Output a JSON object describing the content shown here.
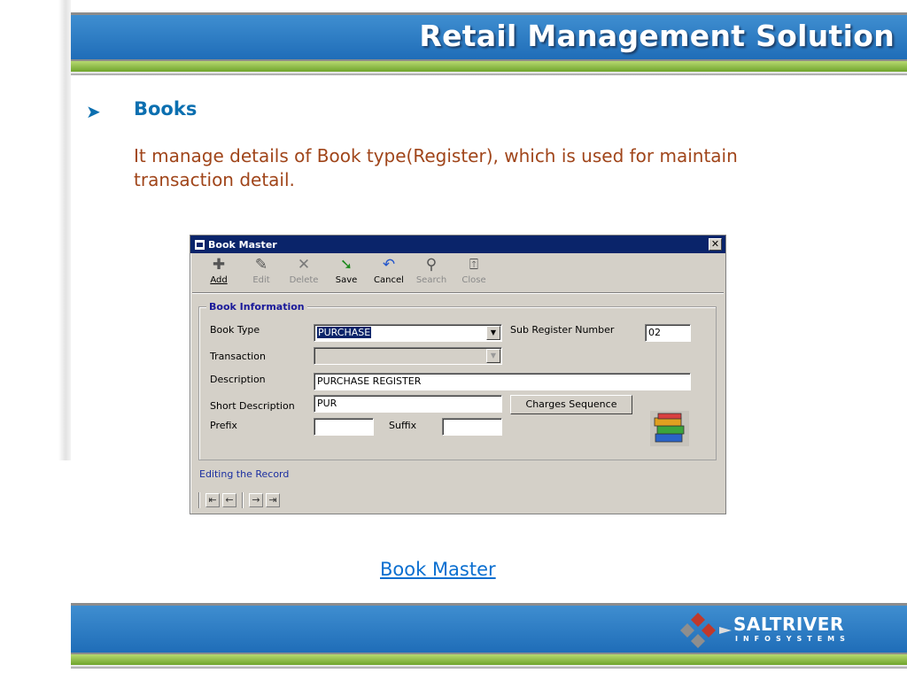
{
  "slide": {
    "header_title": "Retail Management Solution",
    "bullet": "➤",
    "heading": "Books",
    "paragraph": "It manage details of Book type(Register), which is used for maintain transaction detail.",
    "caption": "Book Master"
  },
  "window": {
    "title": "Book Master",
    "close_glyph": "✕",
    "toolbar": [
      {
        "label": "Add",
        "icon": "add-icon",
        "glyph": "✚",
        "enabled": true,
        "color": "#555555"
      },
      {
        "label": "Edit",
        "icon": "edit-icon",
        "glyph": "✎",
        "enabled": false,
        "color": "#555555"
      },
      {
        "label": "Delete",
        "icon": "delete-icon",
        "glyph": "✕",
        "enabled": false,
        "color": "#7a7a7a"
      },
      {
        "label": "Save",
        "icon": "save-icon",
        "glyph": "➘",
        "enabled": true,
        "color": "#1e8a1e"
      },
      {
        "label": "Cancel",
        "icon": "cancel-icon",
        "glyph": "↶",
        "enabled": true,
        "color": "#2255cc"
      },
      {
        "label": "Search",
        "icon": "search-icon",
        "glyph": "⚲",
        "enabled": false,
        "color": "#555555"
      },
      {
        "label": "Close",
        "icon": "close-icon",
        "glyph": "⍐",
        "enabled": false,
        "color": "#555555"
      }
    ],
    "group_title": "Book Information",
    "labels": {
      "book_type": "Book Type",
      "sub_register": "Sub Register Number",
      "transaction": "Transaction",
      "description": "Description",
      "short_description": "Short Description",
      "prefix": "Prefix",
      "suffix": "Suffix"
    },
    "values": {
      "book_type": "PURCHASE",
      "sub_register": "02",
      "transaction": "",
      "description": "PURCHASE REGISTER",
      "short_description": "PUR",
      "prefix": "",
      "suffix": ""
    },
    "charges_button": "Charges Sequence",
    "dropdown_glyph": "▼",
    "status": "Editing the Record",
    "nav": {
      "first": "⇤",
      "prev": "←",
      "next": "→",
      "last": "⇥"
    }
  },
  "footer": {
    "company": "SALTRIVER",
    "company_sub": "INFOSYSTEMS"
  },
  "colors": {
    "banner_blue": "#2a7cc4",
    "banner_green": "#8fbf44",
    "heading": "#0b6fb0",
    "paragraph": "#a0451a",
    "titlebar": "#0a246a"
  }
}
